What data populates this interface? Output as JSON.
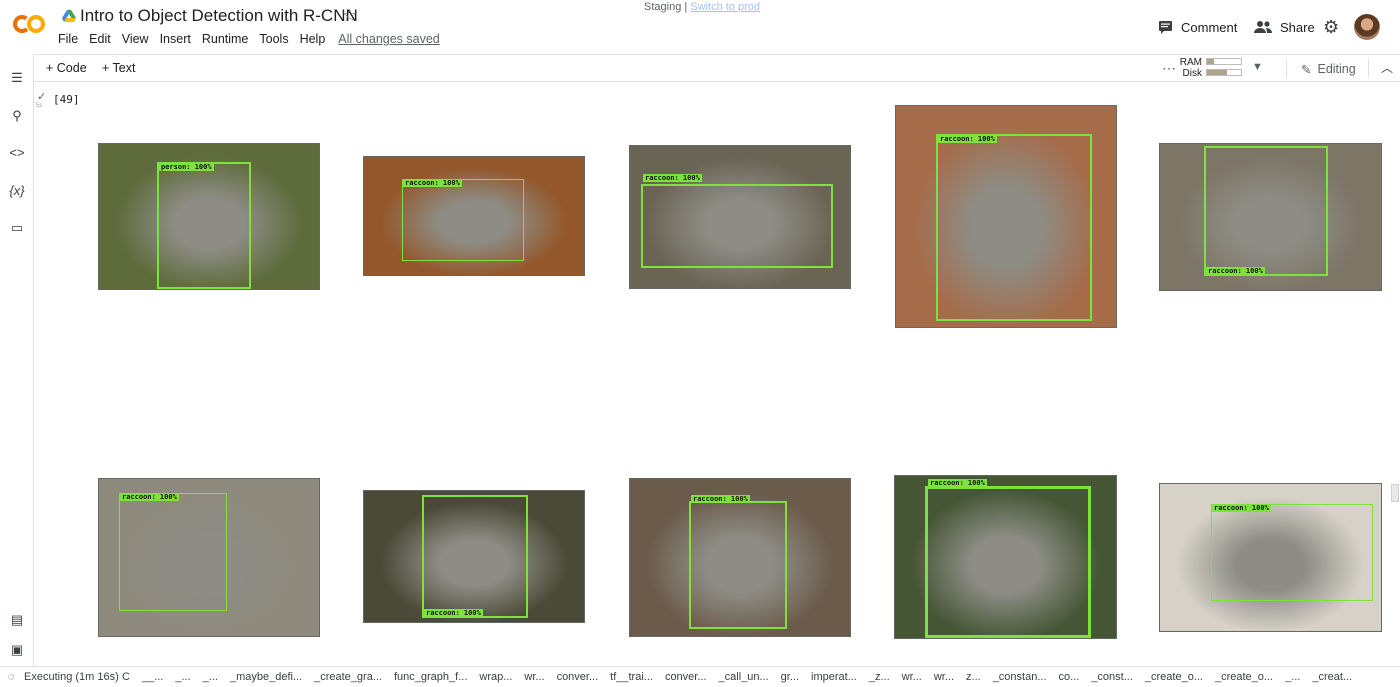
{
  "header": {
    "title": "Intro to Object Detection with R-CNN",
    "env_label": "Staging",
    "env_sep": "|",
    "env_switch": "Switch to prod",
    "comment_label": "Comment",
    "share_label": "Share"
  },
  "menu": {
    "items": [
      "File",
      "Edit",
      "View",
      "Insert",
      "Runtime",
      "Tools",
      "Help"
    ],
    "saved": "All changes saved"
  },
  "toolbar": {
    "add_code": "+ Code",
    "add_text": "+ Text",
    "ram_label": "RAM",
    "disk_label": "Disk",
    "ram_usage": 0.2,
    "disk_usage": 0.6,
    "editing_label": "Editing"
  },
  "sidebar": {
    "icons": [
      "toc-icon",
      "search-icon",
      "code-snippets-icon",
      "variables-icon",
      "files-icon",
      "command-palette-icon",
      "terminal-icon"
    ]
  },
  "cell": {
    "execution_count": "[49]",
    "duration": "5s"
  },
  "detections": [
    {
      "label": "person: 100%",
      "scene": "#5e6b3a"
    },
    {
      "label": "raccoon: 100%",
      "scene": "#94572b"
    },
    {
      "label": "raccoon: 100%",
      "scene": "#6a6455"
    },
    {
      "label": "raccoon: 100%",
      "scene": "#a66b49"
    },
    {
      "label": "raccoon: 100%",
      "scene": "#7d7566"
    },
    {
      "label": "raccoon: 100%",
      "scene": "#8e8a7d"
    },
    {
      "label": "raccoon: 100%",
      "scene": "#4b4a38"
    },
    {
      "label": "raccoon: 100%",
      "scene": "#6b5b4b"
    },
    {
      "label": "raccoon: 100%",
      "scene": "#455635"
    },
    {
      "label": "raccoon: 100%",
      "scene": "#d6d2c8"
    }
  ],
  "status": {
    "executing": "Executing (1m 16s)",
    "trace": [
      "C",
      "__...",
      "_...",
      "_...",
      "_maybe_defi...",
      "_create_gra...",
      "func_graph_f...",
      "wrap...",
      "wr...",
      "conver...",
      "tf__trai...",
      "conver...",
      "_call_un...",
      "gr...",
      "imperat...",
      "_z...",
      "wr...",
      "wr...",
      "z...",
      "_constan...",
      "co...",
      "_const...",
      "_create_o...",
      "_create_o...",
      "_...",
      "_creat..."
    ]
  },
  "colors": {
    "detection_box": "#7ee23d",
    "logo_orange": "#f9ab00",
    "logo_yellow": "#e8710a"
  }
}
